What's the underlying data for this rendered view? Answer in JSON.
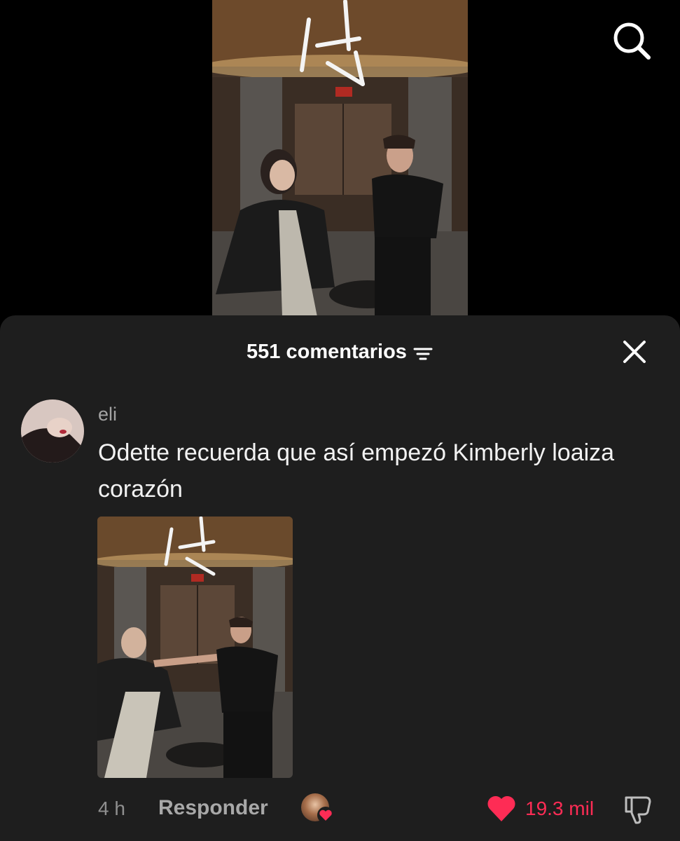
{
  "video": {
    "search_icon": "search-icon"
  },
  "comments_sheet": {
    "count_label": "551 comentarios",
    "sort_icon": "sort-filter-icon",
    "close_icon": "close-icon"
  },
  "comment": {
    "username": "eli",
    "text": "Odette recuerda que así empezó Kimberly loaiza corazón",
    "time": "4 h",
    "reply_label": "Responder",
    "like_count": "19.3 mil",
    "like_icon": "heart-icon",
    "dislike_icon": "thumbs-down-icon"
  },
  "colors": {
    "sheet_bg": "#1e1e1e",
    "like_accent": "#fe2c55",
    "text_primary": "#f2f2f2",
    "text_secondary": "#a3a3a3"
  }
}
